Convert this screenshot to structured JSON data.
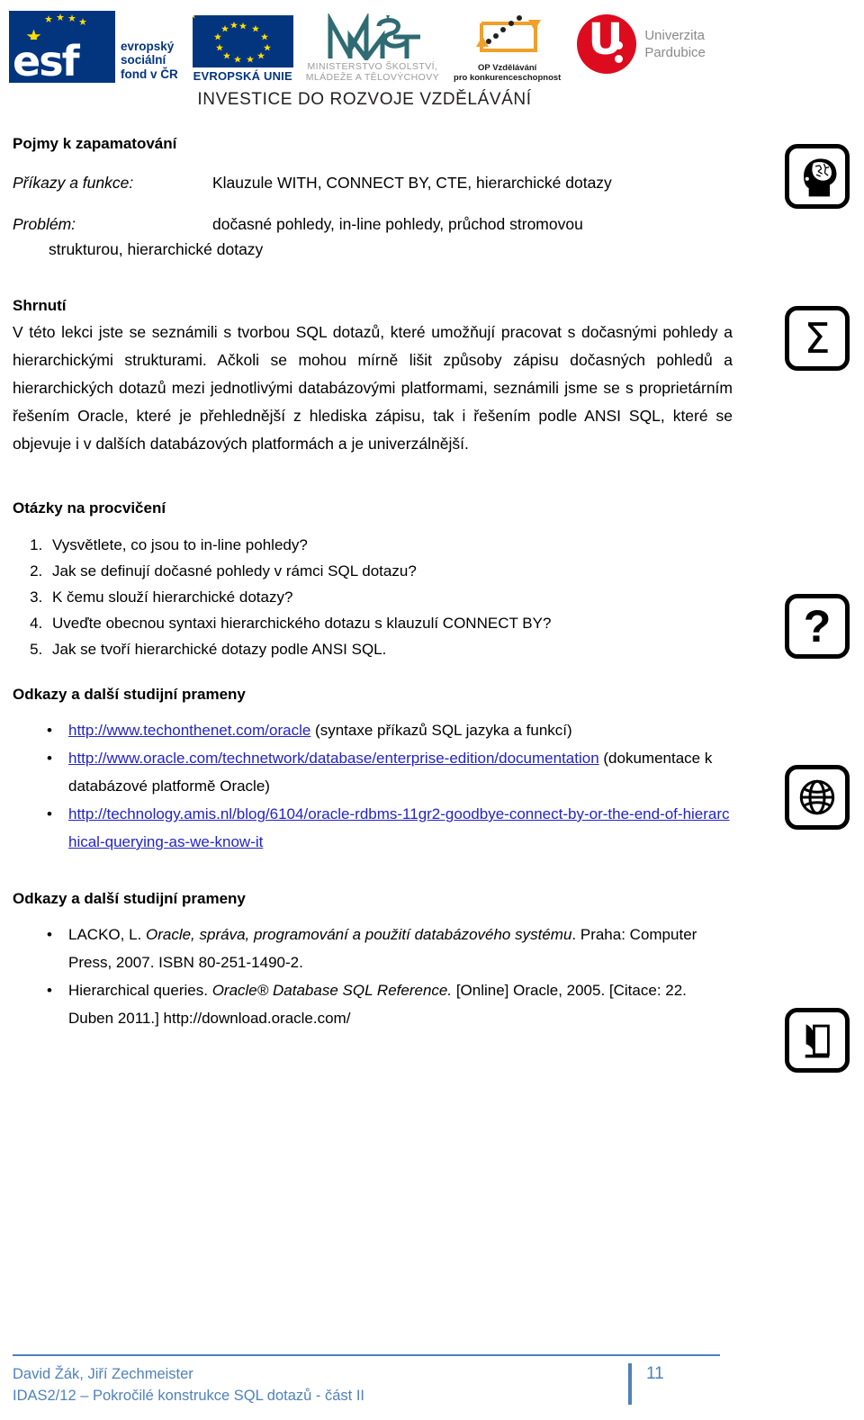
{
  "header": {
    "logos": [
      {
        "name": "esf-logo",
        "letters": "esf",
        "caption_lines": [
          "evropský",
          "sociální",
          "fond v ČR"
        ]
      },
      {
        "name": "eu-logo",
        "caption": "EVROPSKÁ UNIE"
      },
      {
        "name": "msmt-logo",
        "caption_lines": [
          "MINISTERSTVO ŠKOLSTVÍ,",
          "MLÁDEŽE A TĚLOVÝCHOVY"
        ]
      },
      {
        "name": "op-vzdelavani-logo",
        "caption_lines": [
          "OP Vzdělávání",
          "pro konkurenceschopnost"
        ]
      },
      {
        "name": "univerzita-pardubice-logo",
        "letter": "U",
        "caption_lines": [
          "Univerzita",
          "Pardubice"
        ]
      }
    ],
    "banner": "INVESTICE DO ROZVOJE VZDĚLÁVÁNÍ"
  },
  "terms_section": {
    "heading": "Pojmy k zapamatování",
    "icon": "brain-head-icon",
    "rows": [
      {
        "key": "Příkazy a funkce:",
        "value": "Klauzule WITH, CONNECT BY, CTE, hierarchické dotazy",
        "continuation": ""
      },
      {
        "key": "Problém:",
        "value": "dočasné pohledy, in-line pohledy, průchod stromovou",
        "continuation": "strukturou, hierarchické dotazy"
      }
    ]
  },
  "summary_section": {
    "heading": "Shrnutí",
    "icon": "sigma-icon",
    "paragraph": "V této lekci jste se seznámili s tvorbou SQL dotazů, které umožňují pracovat s dočasnými pohledy a hierarchickými strukturami. Ačkoli se mohou mírně lišit způsoby zápisu dočasných pohledů a hierarchických dotazů mezi jednotlivými databázovými platformami, seznámili jsme se s proprietárním řešením Oracle, které je přehlednější z hlediska zápisu, tak i řešením podle ANSI SQL, které se objevuje i v dalších databázových platformách a je univerzálnější."
  },
  "questions_section": {
    "heading": "Otázky na procvičení",
    "icon": "question-mark-icon",
    "items": [
      "Vysvětlete, co jsou to in-line pohledy?",
      "Jak se definují dočasné pohledy v rámci SQL dotazu?",
      "K čemu slouží hierarchické dotazy?",
      "Uveďte obecnou syntaxi hierarchického dotazu s klauzulí CONNECT BY?",
      "Jak se tvoří hierarchické dotazy podle ANSI SQL."
    ]
  },
  "links_section": {
    "heading": "Odkazy a další studijní prameny",
    "icon": "globe-icon",
    "items": [
      {
        "link_text": "http://www.techonthenet.com/oracle",
        "trailing_text": " (syntaxe příkazů SQL jazyka a funkcí)"
      },
      {
        "link_text": "http://www.oracle.com/technetwork/database/enterprise-edition/documentation",
        "trailing_text": " (dokumentace k databázové platformě Oracle)"
      },
      {
        "link_text": "http://technology.amis.nl/blog/6104/oracle-rdbms-11gr2-goodbye-connect-by-or-the-end-of-hierarchical-querying-as-we-know-it",
        "trailing_text": ""
      }
    ]
  },
  "bibliography_section": {
    "heading": "Odkazy a další studijní prameny",
    "icon": "book-icon",
    "items": [
      {
        "prefix": "LACKO, L. ",
        "italic": "Oracle, správa, programování a použití databázového systému",
        "suffix": ". Praha: Computer Press, 2007. ISBN 80-251-1490-2."
      },
      {
        "prefix": "Hierarchical queries. ",
        "italic": "Oracle® Database SQL Reference.",
        "suffix": " [Online] Oracle, 2005. [Citace: 22. Duben 2011.] http://download.oracle.com/"
      }
    ]
  },
  "footer": {
    "authors": "David Žák, Jiří Zechmeister",
    "course": "IDAS2/12 – Pokročilé konstrukce SQL dotazů - část II",
    "page_number": "11"
  },
  "colors": {
    "link": "#2323c8",
    "footer_blue": "#4f81bd",
    "esf_blue": "#03357f",
    "upce_red": "#dd0b1e",
    "opvk_orange": "#f0a029",
    "msmt_teal": "#2e6b73"
  }
}
